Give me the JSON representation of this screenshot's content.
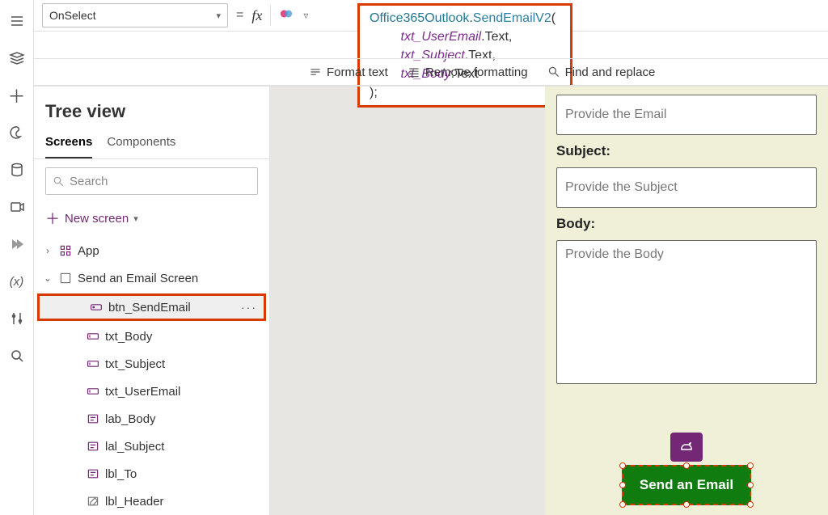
{
  "propbar": {
    "selected": "OnSelect",
    "equals": "=",
    "fx": "fx"
  },
  "formula": {
    "fn": "Office365Outlook",
    "method": "SendEmailV2",
    "args": [
      {
        "id": "txt_UserEmail",
        "prop": "Text"
      },
      {
        "id": "txt_Subject",
        "prop": "Text"
      },
      {
        "id": "txt_Body",
        "prop": "Text"
      }
    ],
    "close": ");"
  },
  "fmtbar": {
    "format": "Format text",
    "remove": "Remove formatting",
    "find": "Find and replace"
  },
  "tree": {
    "title": "Tree view",
    "tabs": {
      "screens": "Screens",
      "components": "Components"
    },
    "search_placeholder": "Search",
    "new_screen": "New screen",
    "nodes": {
      "app": "App",
      "screen": "Send an Email Screen",
      "children": [
        {
          "name": "btn_SendEmail",
          "type": "button",
          "selected": true
        },
        {
          "name": "txt_Body",
          "type": "textinput"
        },
        {
          "name": "txt_Subject",
          "type": "textinput"
        },
        {
          "name": "txt_UserEmail",
          "type": "textinput"
        },
        {
          "name": "lab_Body",
          "type": "label"
        },
        {
          "name": "lal_Subject",
          "type": "label"
        },
        {
          "name": "lbl_To",
          "type": "label"
        },
        {
          "name": "lbl_Header",
          "type": "label-edit"
        }
      ]
    }
  },
  "canvas": {
    "subject_label": "Subject:",
    "body_label": "Body:",
    "email_ph": "Provide the Email",
    "subject_ph": "Provide the Subject",
    "body_ph": "Provide the Body",
    "button": "Send an Email"
  }
}
